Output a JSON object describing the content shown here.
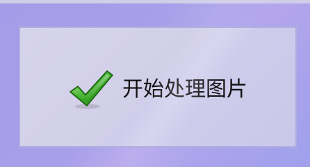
{
  "button": {
    "label": "开始处理图片",
    "icon": "checkmark-icon"
  },
  "colors": {
    "background": "#a59be8",
    "button_face": "#d2cfe9",
    "button_border": "#aeaee0",
    "check_green": "#2e9e1e",
    "label_text": "#111111"
  }
}
